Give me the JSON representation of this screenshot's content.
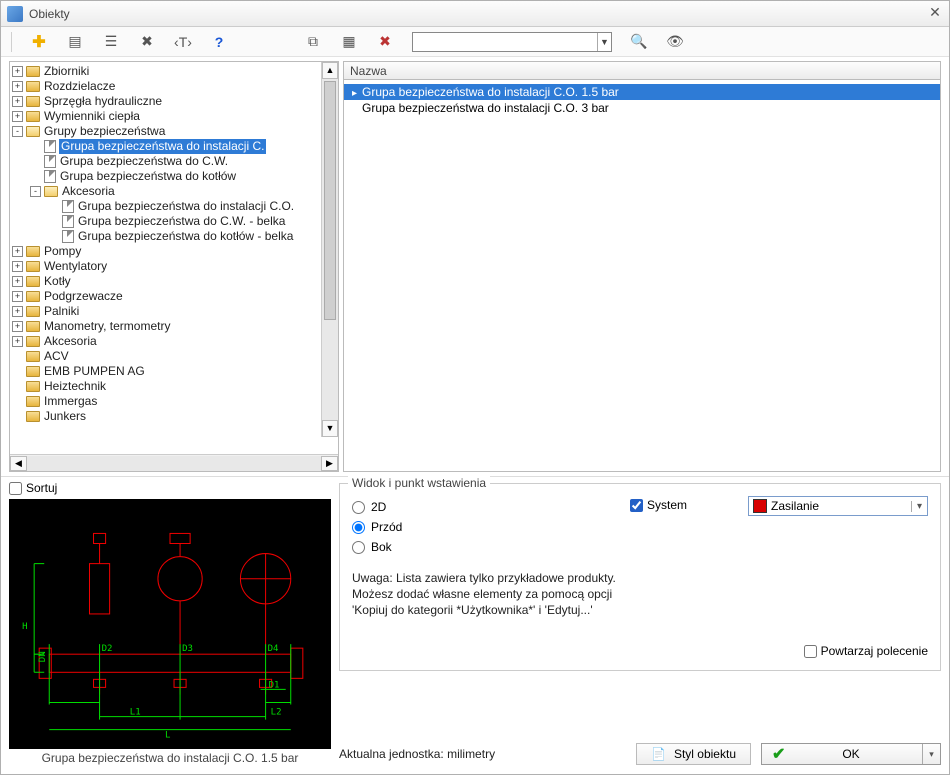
{
  "window": {
    "title": "Obiekty"
  },
  "toolbar": {
    "search_placeholder": ""
  },
  "tree": {
    "nodes": [
      {
        "label": "Zbiorniki",
        "depth": 0,
        "exp": "+"
      },
      {
        "label": "Rozdzielacze",
        "depth": 0,
        "exp": "+"
      },
      {
        "label": "Sprzęgła hydrauliczne",
        "depth": 0,
        "exp": "+"
      },
      {
        "label": "Wymienniki ciepła",
        "depth": 0,
        "exp": "+"
      },
      {
        "label": "Grupy bezpieczeństwa",
        "depth": 0,
        "exp": "-",
        "open": true
      },
      {
        "label": "Grupa bezpieczeństwa do instalacji C.",
        "depth": 1,
        "doc": true,
        "selected": true
      },
      {
        "label": "Grupa bezpieczeństwa do C.W.",
        "depth": 1,
        "doc": true
      },
      {
        "label": "Grupa bezpieczeństwa do kotłów",
        "depth": 1,
        "doc": true
      },
      {
        "label": "Akcesoria",
        "depth": 1,
        "exp": "-",
        "open": true
      },
      {
        "label": "Grupa bezpieczeństwa do instalacji C.O.",
        "depth": 2,
        "doc": true
      },
      {
        "label": "Grupa bezpieczeństwa do C.W. - belka",
        "depth": 2,
        "doc": true
      },
      {
        "label": "Grupa bezpieczeństwa do kotłów - belka",
        "depth": 2,
        "doc": true
      },
      {
        "label": "Pompy",
        "depth": 0,
        "exp": "+"
      },
      {
        "label": "Wentylatory",
        "depth": 0,
        "exp": "+"
      },
      {
        "label": "Kotły",
        "depth": 0,
        "exp": "+"
      },
      {
        "label": "Podgrzewacze",
        "depth": 0,
        "exp": "+"
      },
      {
        "label": "Palniki",
        "depth": 0,
        "exp": "+"
      },
      {
        "label": "Manometry, termometry",
        "depth": 0,
        "exp": "+"
      },
      {
        "label": "Akcesoria",
        "depth": 0,
        "exp": "+"
      },
      {
        "label": "ACV",
        "depth": 0
      },
      {
        "label": "EMB PUMPEN AG",
        "depth": 0
      },
      {
        "label": "Heiztechnik",
        "depth": 0
      },
      {
        "label": "Immergas",
        "depth": 0
      },
      {
        "label": "Junkers",
        "depth": 0
      }
    ]
  },
  "list": {
    "header": "Nazwa",
    "rows": [
      {
        "label": "Grupa bezpieczeństwa do instalacji C.O. 1.5 bar",
        "selected": true
      },
      {
        "label": "Grupa bezpieczeństwa do instalacji C.O. 3 bar",
        "selected": false
      }
    ]
  },
  "sort_label": "Sortuj",
  "preview_caption": "Grupa bezpieczeństwa do instalacji C.O. 1.5 bar",
  "view": {
    "legend": "Widok i punkt wstawienia",
    "options": {
      "o2d": "2D",
      "front": "Przód",
      "side": "Bok"
    },
    "selected": "front",
    "system_label": "System",
    "feed_label": "Zasilanie",
    "note_line1": "Uwaga: Lista zawiera tylko przykładowe produkty.",
    "note_line2": "Możesz dodać własne elementy za pomocą opcji",
    "note_line3": "'Kopiuj do kategorii *Użytkownika*' i 'Edytuj...'",
    "repeat_label": "Powtarzaj polecenie"
  },
  "bottom": {
    "unit_label": "Aktualna jednostka: milimetry",
    "style_label": "Styl obiektu",
    "ok_label": "OK"
  }
}
